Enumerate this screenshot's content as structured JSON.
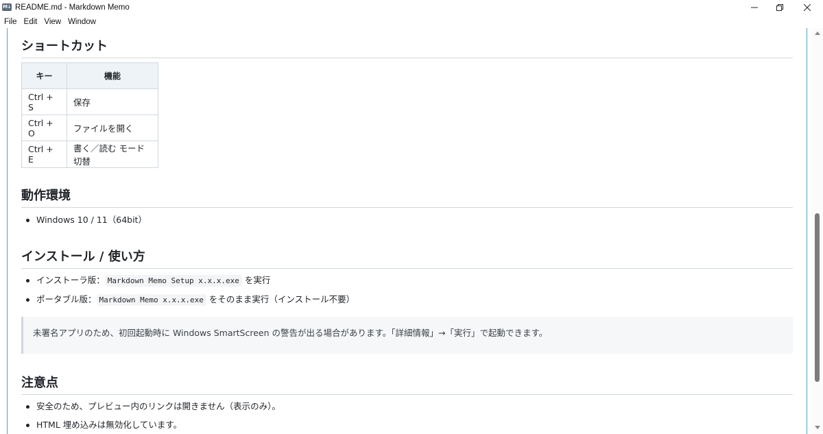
{
  "window": {
    "app_icon_label": "M↓",
    "title": "README.md - Markdown Memo"
  },
  "menu": [
    "File",
    "Edit",
    "View",
    "Window"
  ],
  "sections": {
    "shortcuts": {
      "heading": "ショートカット",
      "table": {
        "headers": [
          "キー",
          "機能"
        ],
        "rows": [
          [
            "Ctrl + S",
            "保存"
          ],
          [
            "Ctrl + O",
            "ファイルを開く"
          ],
          [
            "Ctrl + E",
            "書く／読む モード切替"
          ]
        ]
      }
    },
    "environment": {
      "heading": "動作環境",
      "items": [
        "Windows 10 / 11（64bit）"
      ]
    },
    "install": {
      "heading": "インストール / 使い方",
      "item1": {
        "prefix": "インストーラ版：",
        "code": "Markdown Memo Setup x.x.x.exe",
        "suffix": "を実行"
      },
      "item2": {
        "prefix": "ポータブル版：",
        "code": "Markdown Memo x.x.x.exe",
        "suffix": "をそのまま実行（インストール不要）"
      },
      "note": "未署名アプリのため、初回起動時に Windows SmartScreen の警告が出る場合があります。「詳細情報」→「実行」で起動できます。"
    },
    "notes": {
      "heading": "注意点",
      "items": [
        "安全のため、プレビュー内のリンクは開きません（表示のみ）。",
        "HTML 埋め込みは無効化しています。"
      ]
    }
  },
  "colors": {
    "accent_border": "#4aa3c7",
    "table_header_bg": "#eef3f8",
    "note_bg": "#f5f7f9"
  }
}
